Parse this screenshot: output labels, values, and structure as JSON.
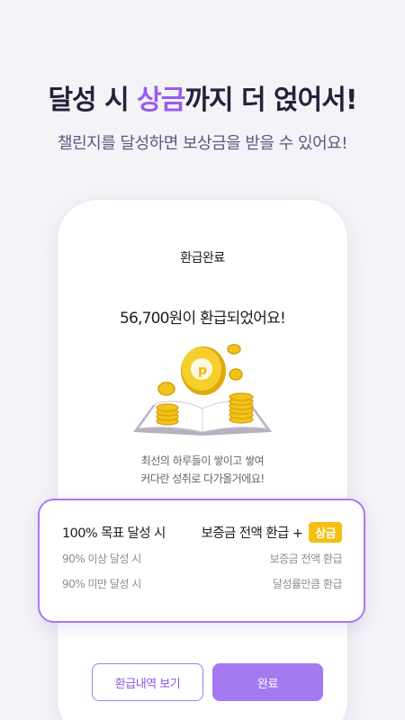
{
  "promo": {
    "headline_pre": "달성 시 ",
    "headline_accent": "상금",
    "headline_post": "까지 더 얹어서!",
    "subheadline": "챌린지를 달성하면 보상금을 받을 수 있어요!"
  },
  "screen": {
    "title": "환급완료",
    "refund_message": "56,700원이 환급되었어요!",
    "caption_line1": "최선의 하루들이 쌓이고 쌓여",
    "caption_line2": "커다란 성취로 다가올거에요!"
  },
  "reward_card": {
    "rows": [
      {
        "condition": "100% 목표 달성 시",
        "reward": "보증금 전액 환급 + ",
        "badge": "상금"
      },
      {
        "condition": "90% 이상 달성 시",
        "reward": "보증금 전액 환급"
      },
      {
        "condition": "90% 미만 달성 시",
        "reward": "달성률만큼 환급"
      }
    ]
  },
  "buttons": {
    "history_label": "환급내역 보기",
    "done_label": "완료"
  },
  "colors": {
    "accent": "#9a5cf0",
    "card_border": "#a57af0",
    "badge": "#f5c012",
    "coin": "#f2c318"
  },
  "icons": {
    "illustration": "book-with-gold-coins"
  }
}
